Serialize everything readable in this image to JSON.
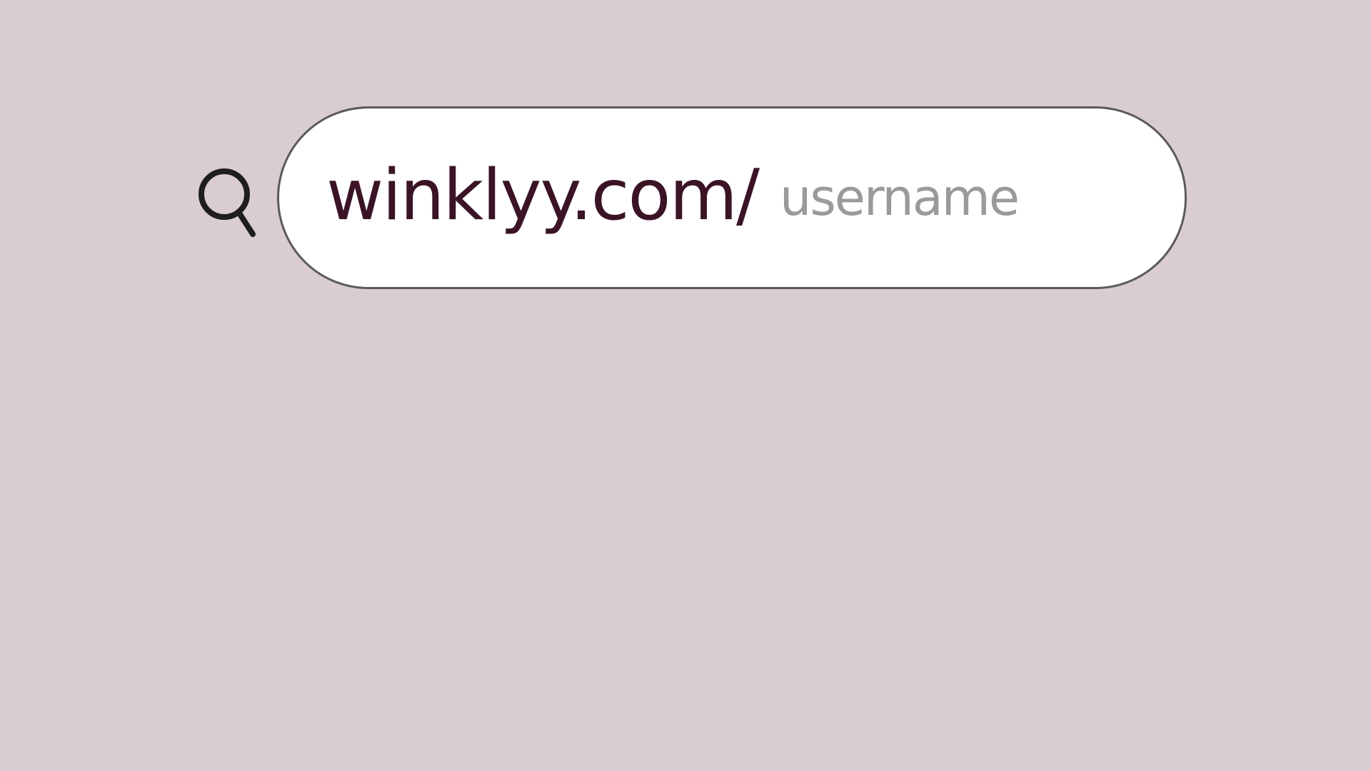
{
  "search": {
    "icon": "search-icon",
    "prefix": "winklyy.com/",
    "placeholder": "username",
    "value": ""
  },
  "colors": {
    "background": "#d9ccd3",
    "prefix_text": "#3a1426",
    "placeholder_text": "#9a9a9a",
    "bar_fill": "#ffffff",
    "bar_border": "#5a5a5a"
  }
}
